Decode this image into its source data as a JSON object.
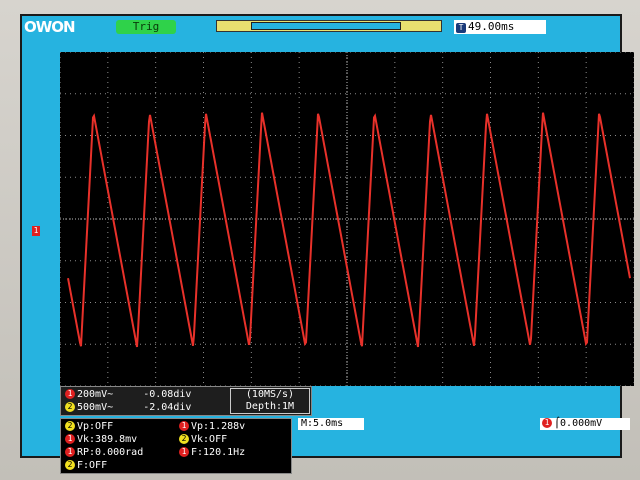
{
  "header": {
    "logo": "OWON",
    "trigger_status": "Trig",
    "time_offset": "49.00ms",
    "time_icon": "T"
  },
  "channel": {
    "marker": "1",
    "color": "#e02020"
  },
  "status": {
    "ch1_line": "200mV~     -0.08div",
    "ch2_line": "500mV~     -2.04div",
    "ch1_badge": "1",
    "ch2_badge": "2",
    "sample_rate": "(10MS/s)",
    "depth": "Depth:1M"
  },
  "measurements": {
    "vp_ch2": "Vp:OFF",
    "vp_ch1": "Vp:1.288v",
    "vk_ch1": "Vk:389.8mv",
    "vk_ch2": "Vk:OFF",
    "rp_ch1": "RP:0.000rad",
    "f_ch1": "F:120.1Hz",
    "f_ch2": "F:OFF",
    "badge_yellow": "2",
    "badge_red": "1"
  },
  "timebase": {
    "horizontal": "M:5.0ms",
    "trigger_level": "0.000mV",
    "trigger_badge": "1"
  },
  "waveform": {
    "type": "triangle",
    "frequency_hz": 120.1,
    "grid": true,
    "color": "#e8312a"
  }
}
